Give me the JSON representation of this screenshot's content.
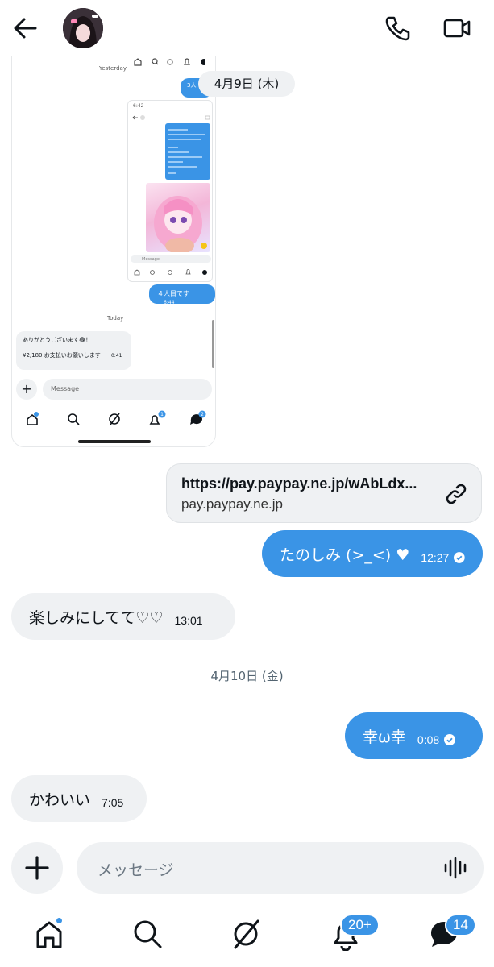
{
  "header": {
    "back_icon": "arrow-left-icon",
    "call_icon": "phone-icon",
    "video_icon": "video-camera-icon"
  },
  "screenshot": {
    "yesterday": "Yesterday",
    "partial_bubble": "3人",
    "inner_composer": "Message",
    "fourth_person": "４人目です",
    "fourth_time": "6:44",
    "today": "Today",
    "thanks_line1": "ありがとうございます😂！",
    "thanks_line2": "¥2,180 お支払いお願いします！",
    "thanks_time": "0:41",
    "composer_placeholder": "Message",
    "inner_time": "6:42",
    "nav_badge_notifications": "1",
    "nav_badge_messages": "2"
  },
  "date_pill": "4月9日 (木)",
  "link_card": {
    "url": "https://pay.paypay.ne.jp/wAbLdx...",
    "domain": "pay.paypay.ne.jp"
  },
  "messages": [
    {
      "direction": "out",
      "text": "たのしみ (>_<) ♥",
      "time": "12:27"
    },
    {
      "direction": "in",
      "text": "楽しみにしてて♡♡",
      "time": "13:01"
    },
    {
      "direction": "out",
      "text": "幸ω幸",
      "time": "0:08"
    },
    {
      "direction": "in",
      "text": "かわいい",
      "time": "7:05"
    }
  ],
  "day_separator": "4月10日 (金)",
  "composer": {
    "placeholder": "メッセージ"
  },
  "nav": {
    "notifications_badge": "20+",
    "messages_badge": "14"
  },
  "colors": {
    "accent": "#3a94e6",
    "bubble_in": "#eff1f3"
  }
}
